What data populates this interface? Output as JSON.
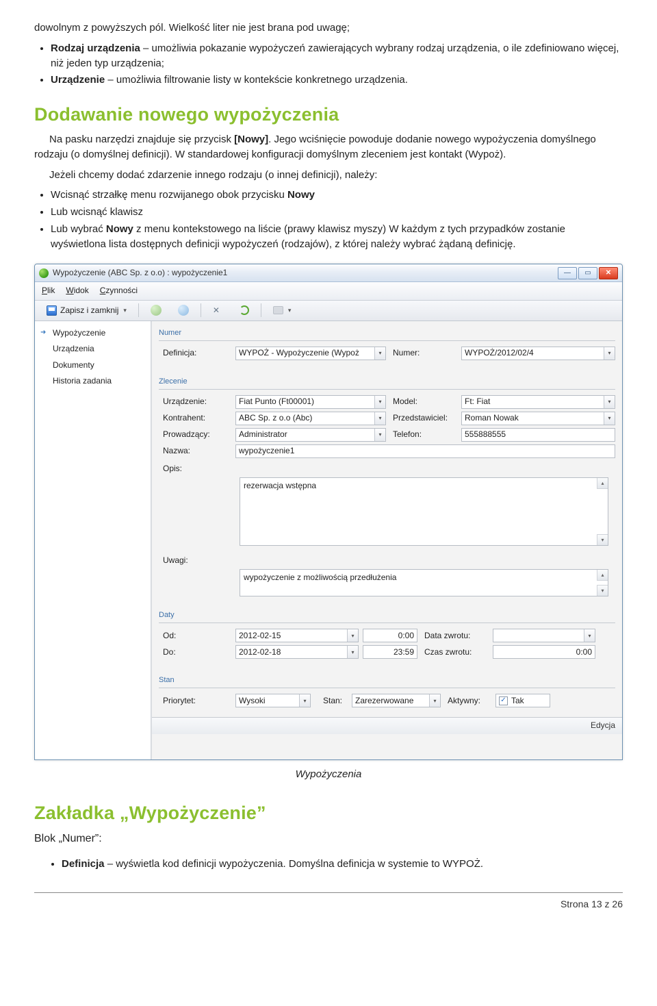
{
  "doc": {
    "top_line": "dowolnym z powyższych pól. Wielkość liter nie jest brana pod uwagę;",
    "bullet_rodzaj_b": "Rodzaj urządzenia",
    "bullet_rodzaj_t": " – umożliwia pokazanie wypożyczeń zawierających wybrany rodzaj urządzenia, o ile zdefiniowano więcej, niż jeden typ urządzenia;",
    "bullet_urz_b": "Urządzenie",
    "bullet_urz_t": " – umożliwia filtrowanie listy w kontekście konkretnego urządzenia.",
    "h_add": "Dodawanie nowego wypożyczenia",
    "p_add_1a": "Na pasku narzędzi znajduje się przycisk ",
    "p_add_1b": "[Nowy]",
    "p_add_1c": ". Jego wciśnięcie powoduje dodanie nowego wypożyczenia domyślnego rodzaju (o domyślnej definicji). W standardowej konfiguracji domyślnym zleceniem jest kontakt (Wypoż).",
    "p_add_2": "Jeżeli chcemy dodać zdarzenie innego rodzaju (o innej definicji), należy:",
    "li_a1": "Wcisnąć strzałkę menu rozwijanego obok przycisku ",
    "li_a1b": "Nowy",
    "li_b": "Lub wcisnąć klawisz",
    "li_c1": "Lub wybrać ",
    "li_c1b": "Nowy",
    "li_c2": " z menu kontekstowego na liście (prawy klawisz myszy) W każdym z tych przypadków zostanie wyświetlona lista dostępnych definicji wypożyczeń (rodzajów), z której należy wybrać żądaną definicję.",
    "caption": "Wypożyczenia",
    "h_tab": "Zakładka „Wypożyczenie”",
    "sub_blok": "Blok „Numer”:",
    "li_def_b": "Definicja",
    "li_def_t": " – wyświetla kod definicji wypożyczenia. Domyślna definicja w systemie to WYPOŻ.",
    "footer": "Strona 13 z 26"
  },
  "win": {
    "title": "Wypożyczenie (ABC Sp. z o.o) : wypożyczenie1",
    "menu_file": "Plik",
    "menu_view": "Widok",
    "menu_actions": "Czynności",
    "save_close": "Zapisz i zamknij",
    "sidebar": {
      "i0": "Wypożyczenie",
      "i1": "Urządzenia",
      "i2": "Dokumenty",
      "i3": "Historia zadania"
    },
    "grp_numer": "Numer",
    "lbl_def": "Definicja:",
    "val_def": "WYPOŻ - Wypożyczenie (Wypoż",
    "lbl_num": "Numer:",
    "val_num": "WYPOŻ/2012/02/4",
    "grp_zlec": "Zlecenie",
    "lbl_urz": "Urządzenie:",
    "val_urz": "Fiat Punto (Ft00001)",
    "lbl_model": "Model:",
    "val_model": "Ft: Fiat",
    "lbl_kontr": "Kontrahent:",
    "val_kontr": "ABC Sp. z o.o (Abc)",
    "lbl_przed": "Przedstawiciel:",
    "val_przed": "Roman Nowak",
    "lbl_prow": "Prowadzący:",
    "val_prow": "Administrator",
    "lbl_tel": "Telefon:",
    "val_tel": "555888555",
    "lbl_naz": "Nazwa:",
    "val_naz": "wypożyczenie1",
    "lbl_opis": "Opis:",
    "val_opis": "rezerwacja wstępna",
    "lbl_uwagi": "Uwagi:",
    "val_uwagi": "wypożyczenie z możliwością przedłużenia",
    "grp_daty": "Daty",
    "lbl_od": "Od:",
    "val_od_d": "2012-02-15",
    "val_od_t": "0:00",
    "lbl_datazw": "Data zwrotu:",
    "lbl_do": "Do:",
    "val_do_d": "2012-02-18",
    "val_do_t": "23:59",
    "lbl_czaszw": "Czas zwrotu:",
    "val_czaszw": "0:00",
    "grp_stan": "Stan",
    "lbl_prio": "Priorytet:",
    "val_prio": "Wysoki",
    "lbl_stan": "Stan:",
    "val_stan": "Zarezerwowane",
    "lbl_akt": "Aktywny:",
    "val_akt": "Tak",
    "status": "Edycja"
  }
}
